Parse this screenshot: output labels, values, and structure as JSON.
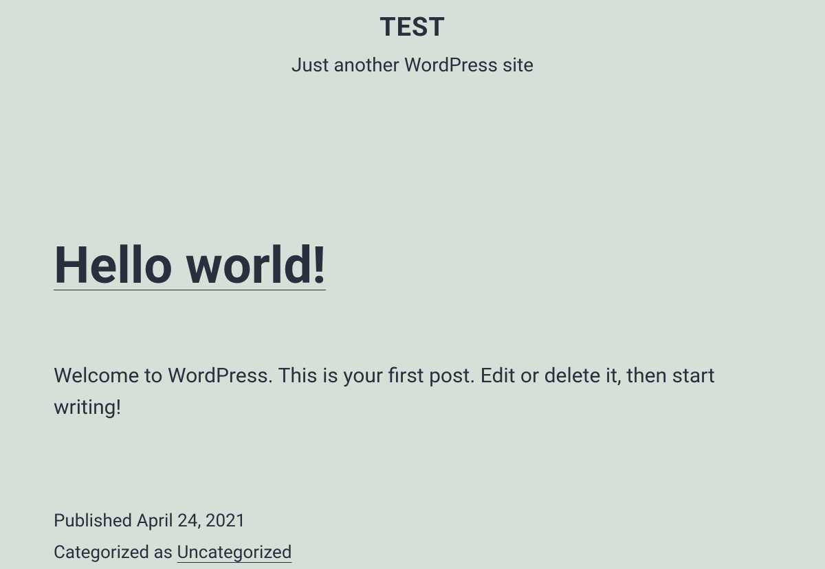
{
  "header": {
    "site_title": "TEST",
    "tagline": "Just another WordPress site"
  },
  "post": {
    "title": "Hello world!",
    "excerpt": "Welcome to WordPress. This is your first post. Edit or delete it, then start writing!",
    "meta": {
      "published_label": "Published ",
      "published_date": "April 24, 2021",
      "categorized_label": "Categorized as ",
      "category": "Uncategorized"
    }
  }
}
